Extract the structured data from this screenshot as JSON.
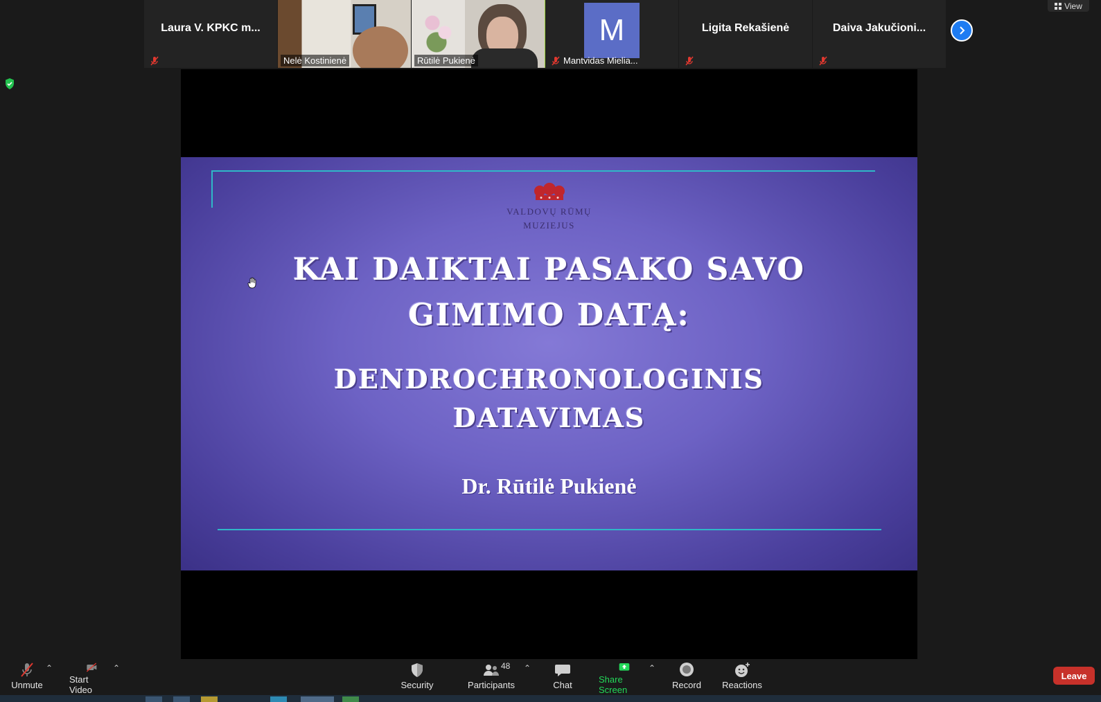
{
  "participants": [
    {
      "name": "Laura V. KPKC m...",
      "muted": true,
      "video": false
    },
    {
      "name": "Nelė Kostinienė",
      "muted": false,
      "video": true
    },
    {
      "name": "Rūtilė Pukienė",
      "muted": false,
      "video": true,
      "active": true
    },
    {
      "name": "Mantvidas Mielia...",
      "muted": true,
      "video": false,
      "avatar_letter": "M"
    },
    {
      "name": "Ligita Rekašienė",
      "muted": true,
      "video": false
    },
    {
      "name": "Daiva  Jakučioni...",
      "muted": true,
      "video": false
    }
  ],
  "view_label": "View",
  "slide": {
    "logo_line1": "VALDOVŲ RŪMŲ",
    "logo_line2": "MUZIEJUS",
    "title_line1": "KAI DAIKTAI PASAKO SAVO",
    "title_line2": "GIMIMO DATĄ:",
    "subtitle_line1": "DENDROCHRONOLOGINIS",
    "subtitle_line2": "DATAVIMAS",
    "author": "Dr. Rūtilė Pukienė"
  },
  "toolbar": {
    "unmute": "Unmute",
    "start_video": "Start Video",
    "security": "Security",
    "participants": "Participants",
    "participants_count": "48",
    "chat": "Chat",
    "share_screen": "Share Screen",
    "record": "Record",
    "reactions": "Reactions",
    "leave": "Leave"
  },
  "colors": {
    "accent_blue": "#1e7cf2",
    "share_green": "#23d959",
    "leave_red": "#c7312a",
    "active_speaker": "#9bd234",
    "mute_red": "#e0382f"
  }
}
